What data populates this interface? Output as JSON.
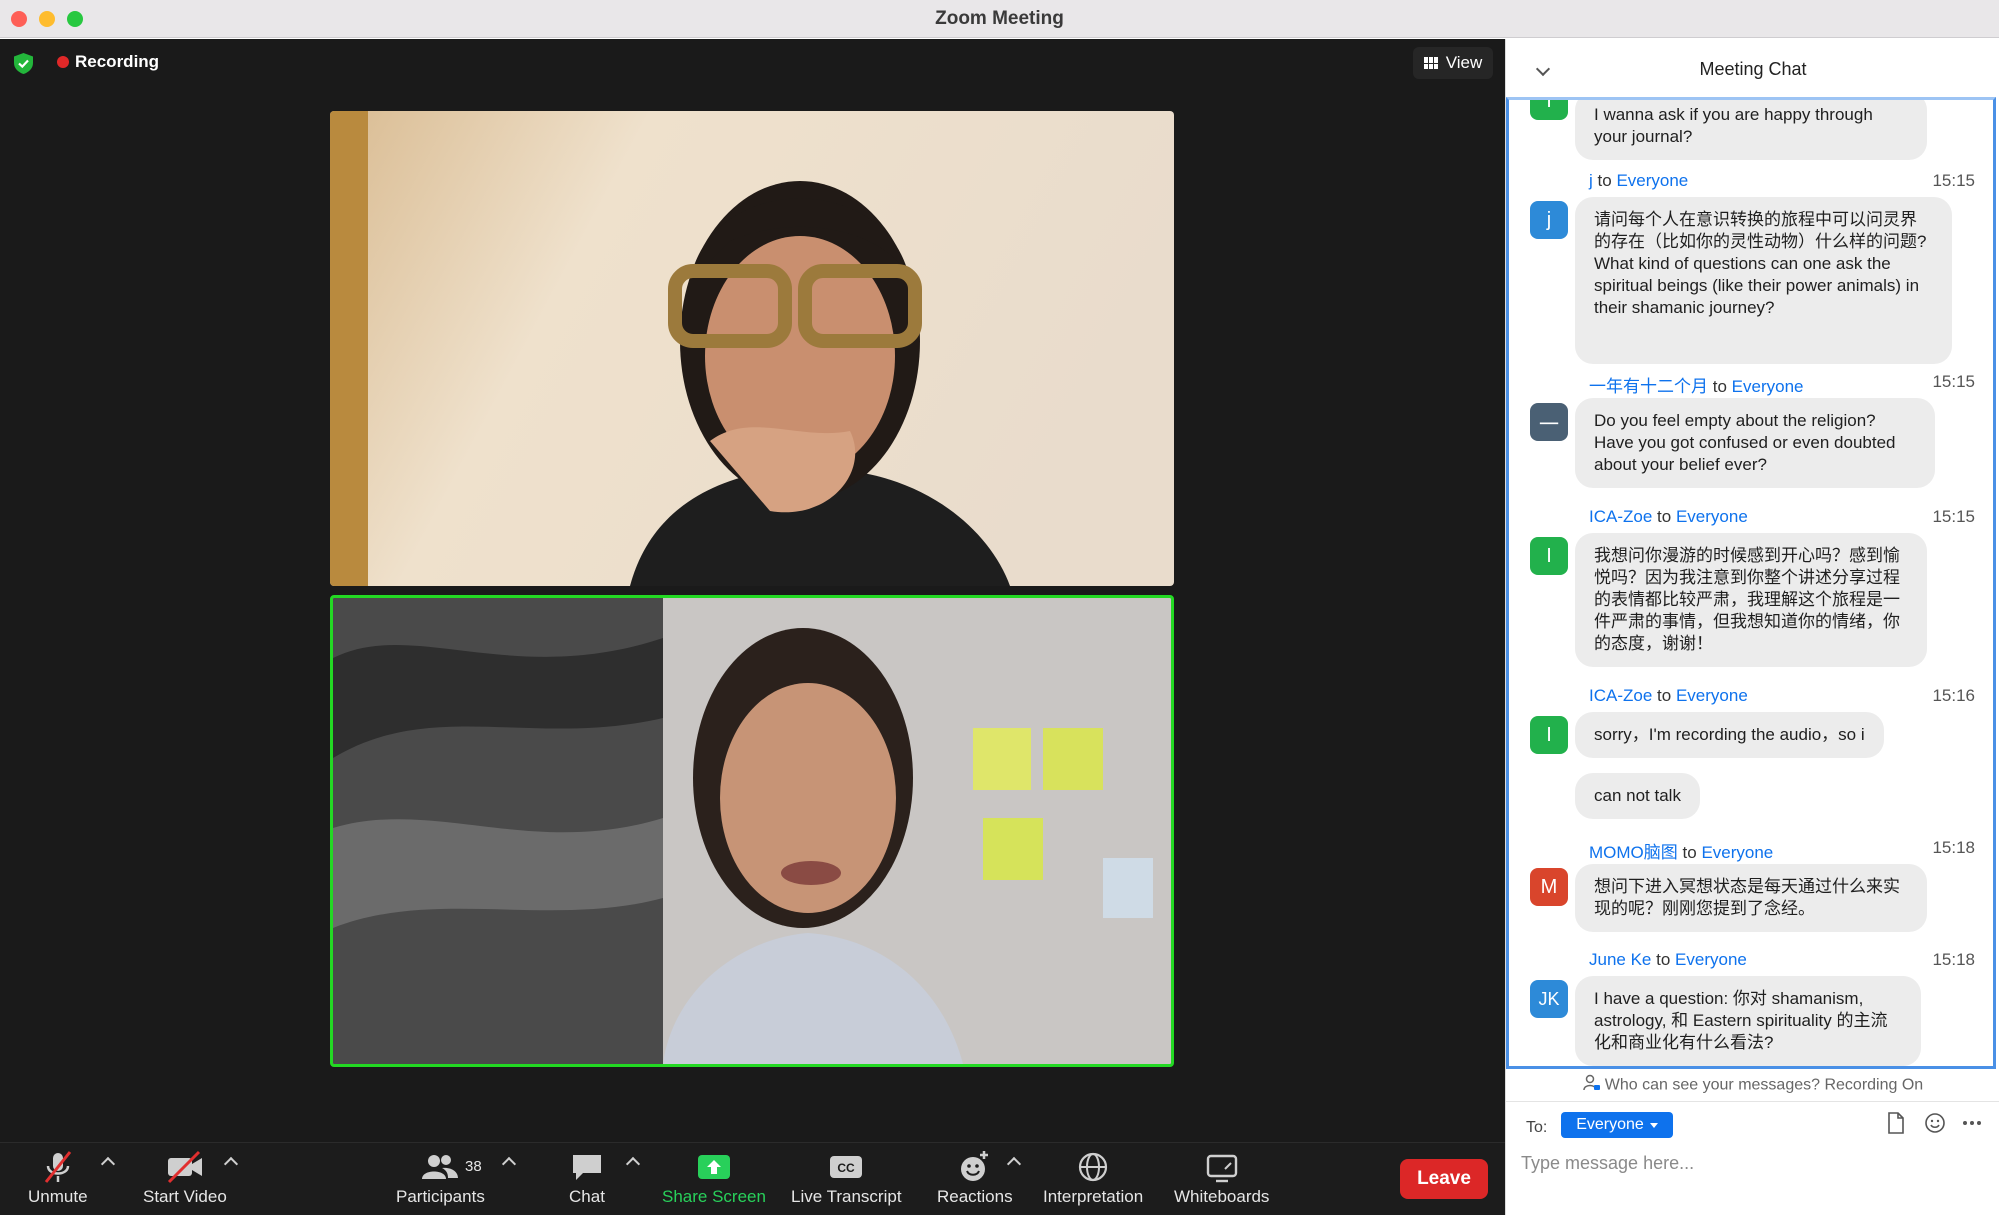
{
  "window": {
    "title": "Zoom Meeting"
  },
  "meeting": {
    "recording_label": "Recording",
    "view_label": "View",
    "security_icon": "shield-check-icon"
  },
  "toolbar": {
    "unmute": "Unmute",
    "start_video": "Start Video",
    "participants": "Participants",
    "participant_count": "38",
    "chat": "Chat",
    "share_screen": "Share Screen",
    "live_transcript": "Live Transcript",
    "reactions": "Reactions",
    "interpretation": "Interpretation",
    "whiteboards": "Whiteboards",
    "leave": "Leave",
    "share_color": "#28d05a",
    "leave_color": "#dc2727"
  },
  "chat": {
    "title": "Meeting Chat",
    "messages": [
      {
        "avatar": "I",
        "avatar_color": "#22b14c",
        "sender": "",
        "to": "",
        "time": "",
        "text": "I wanna ask if you are happy through your journal?"
      },
      {
        "avatar": "j",
        "avatar_color": "#2d8ad8",
        "sender": "j",
        "to_word": "to",
        "to": "Everyone",
        "time": "15:15",
        "text": "请问每个人在意识转换的旅程中可以问灵界的存在（比如你的灵性动物）什么样的问题? What kind of questions can one ask the spiritual beings (like their power animals) in their shamanic journey?"
      },
      {
        "avatar": "一",
        "avatar_color": "#4a6074",
        "sender": "一年有十二个月",
        "to_word": "to",
        "to": "Everyone",
        "time": "15:15",
        "text": "Do you feel empty about the religion? Have you got confused or even doubted about your belief ever?"
      },
      {
        "avatar": "I",
        "avatar_color": "#22b14c",
        "sender": "ICA-Zoe",
        "to_word": "to",
        "to": "Everyone",
        "time": "15:15",
        "text": "我想问你漫游的时候感到开心吗？感到愉悦吗？因为我注意到你整个讲述分享过程的表情都比较严肃，我理解这个旅程是一件严肃的事情，但我想知道你的情绪，你的态度，谢谢！"
      },
      {
        "avatar": "I",
        "avatar_color": "#22b14c",
        "sender": "ICA-Zoe",
        "to_word": "to",
        "to": "Everyone",
        "time": "15:16",
        "text": "sorry，I'm recording the audio，so i",
        "text2": "can not talk"
      },
      {
        "avatar": "M",
        "avatar_color": "#d9452c",
        "sender": "MOMO脑图",
        "to_word": "to",
        "to": "Everyone",
        "time": "15:18",
        "text": "想问下进入冥想状态是每天通过什么来实现的呢？刚刚您提到了念经。"
      },
      {
        "avatar": "JK",
        "avatar_color": "#2d8ad8",
        "sender": "June Ke",
        "to_word": "to",
        "to": "Everyone",
        "time": "15:18",
        "text": "I have a question: 你对 shamanism, astrology, 和 Eastern spirituality 的主流化和商业化有什么看法?"
      }
    ],
    "privacy_notice": "Who can see your messages? Recording On",
    "to_label": "To:",
    "to_value": "Everyone",
    "input_placeholder": "Type message here..."
  }
}
